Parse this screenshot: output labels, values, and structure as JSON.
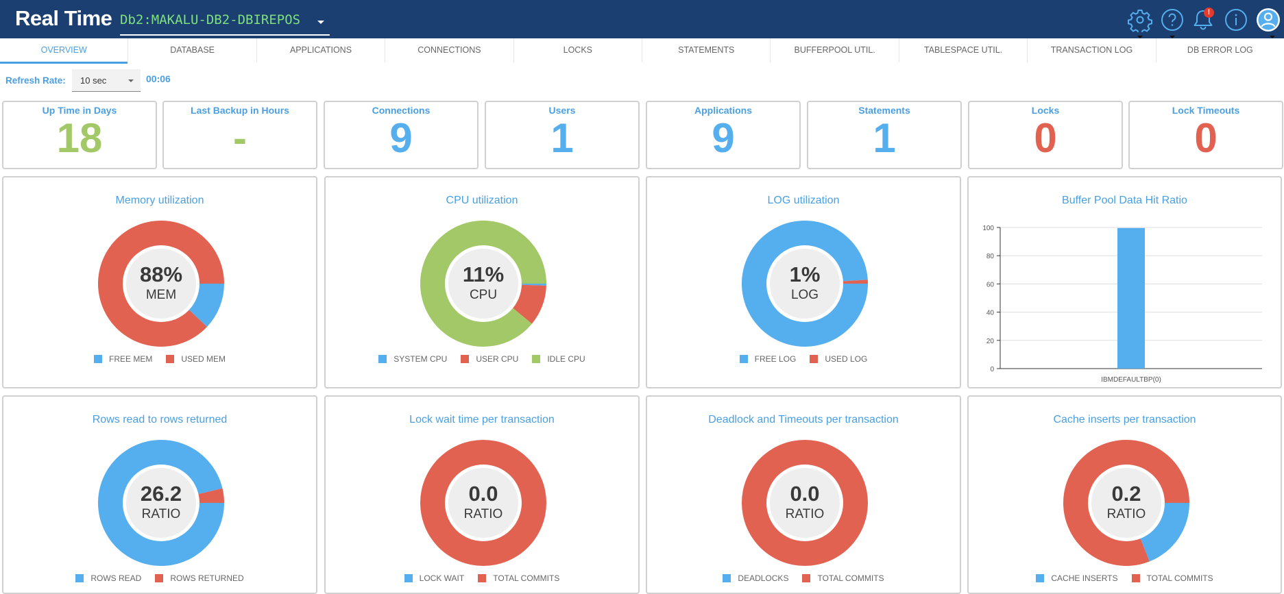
{
  "header": {
    "title": "Real Time",
    "database": "Db2:MAKALU-DB2-DBIREPOS",
    "icons": [
      "gear-icon",
      "help-icon",
      "bell-icon",
      "info-icon",
      "user-avatar-icon"
    ],
    "notification_badge": "!"
  },
  "tabs": [
    {
      "label": "OVERVIEW",
      "active": true
    },
    {
      "label": "DATABASE",
      "active": false
    },
    {
      "label": "APPLICATIONS",
      "active": false
    },
    {
      "label": "CONNECTIONS",
      "active": false
    },
    {
      "label": "LOCKS",
      "active": false
    },
    {
      "label": "STATEMENTS",
      "active": false
    },
    {
      "label": "BUFFERPOOL UTIL.",
      "active": false
    },
    {
      "label": "TABLESPACE UTIL.",
      "active": false
    },
    {
      "label": "TRANSACTION LOG",
      "active": false
    },
    {
      "label": "DB ERROR LOG",
      "active": false
    }
  ],
  "refresh": {
    "label": "Refresh Rate:",
    "value": "10 sec",
    "timer": "00:06"
  },
  "colors": {
    "blue": "#55aeed",
    "red": "#e26252",
    "green": "#a3c868",
    "title_blue": "#4a9fe3",
    "header_bg": "#1b3f70"
  },
  "kpis": [
    {
      "title": "Up Time in Days",
      "value": "18",
      "color": "#a3c868"
    },
    {
      "title": "Last Backup in Hours",
      "value": "-",
      "color": "#a3c868"
    },
    {
      "title": "Connections",
      "value": "9",
      "color": "#55aeed"
    },
    {
      "title": "Users",
      "value": "1",
      "color": "#55aeed"
    },
    {
      "title": "Applications",
      "value": "9",
      "color": "#55aeed"
    },
    {
      "title": "Statements",
      "value": "1",
      "color": "#55aeed"
    },
    {
      "title": "Locks",
      "value": "0",
      "color": "#e26252"
    },
    {
      "title": "Lock Timeouts",
      "value": "0",
      "color": "#e26252"
    }
  ],
  "chart_data": [
    {
      "type": "pie",
      "title": "Memory utilization",
      "center_value": "88%",
      "center_unit": "MEM",
      "categories": [
        "FREE MEM",
        "USED MEM"
      ],
      "values": [
        12,
        88
      ],
      "colors": [
        "#55aeed",
        "#e26252"
      ]
    },
    {
      "type": "pie",
      "title": "CPU utilization",
      "center_value": "11%",
      "center_unit": "CPU",
      "categories": [
        "SYSTEM CPU",
        "USER CPU",
        "IDLE CPU"
      ],
      "values": [
        0.5,
        10.5,
        89
      ],
      "colors": [
        "#55aeed",
        "#e26252",
        "#a3c868"
      ]
    },
    {
      "type": "pie",
      "title": "LOG utilization",
      "center_value": "1%",
      "center_unit": "LOG",
      "categories": [
        "FREE LOG",
        "USED LOG"
      ],
      "values": [
        99,
        1
      ],
      "colors": [
        "#55aeed",
        "#e26252"
      ]
    },
    {
      "type": "bar",
      "title": "Buffer Pool Data Hit Ratio",
      "categories": [
        "IBMDEFAULTBP(0)"
      ],
      "values": [
        99.6
      ],
      "color": "#55aeed",
      "ylim": [
        0,
        100
      ],
      "yticks": [
        0,
        20,
        40,
        60,
        80,
        100
      ],
      "grid": true
    },
    {
      "type": "pie",
      "title": "Rows read to rows returned",
      "center_value": "26.2",
      "center_unit": "RATIO",
      "categories": [
        "ROWS READ",
        "ROWS RETURNED"
      ],
      "values": [
        96.3,
        3.7
      ],
      "colors": [
        "#55aeed",
        "#e26252"
      ]
    },
    {
      "type": "pie",
      "title": "Lock wait time per transaction",
      "center_value": "0.0",
      "center_unit": "RATIO",
      "categories": [
        "LOCK WAIT",
        "TOTAL COMMITS"
      ],
      "values": [
        0,
        100
      ],
      "colors": [
        "#55aeed",
        "#e26252"
      ]
    },
    {
      "type": "pie",
      "title": "Deadlock and Timeouts per transaction",
      "center_value": "0.0",
      "center_unit": "RATIO",
      "categories": [
        "DEADLOCKS",
        "TOTAL COMMITS"
      ],
      "values": [
        0,
        100
      ],
      "colors": [
        "#55aeed",
        "#e26252"
      ]
    },
    {
      "type": "pie",
      "title": "Cache inserts per transaction",
      "center_value": "0.2",
      "center_unit": "RATIO",
      "categories": [
        "CACHE INSERTS",
        "TOTAL COMMITS"
      ],
      "values": [
        19,
        81
      ],
      "colors": [
        "#55aeed",
        "#e26252"
      ]
    }
  ]
}
